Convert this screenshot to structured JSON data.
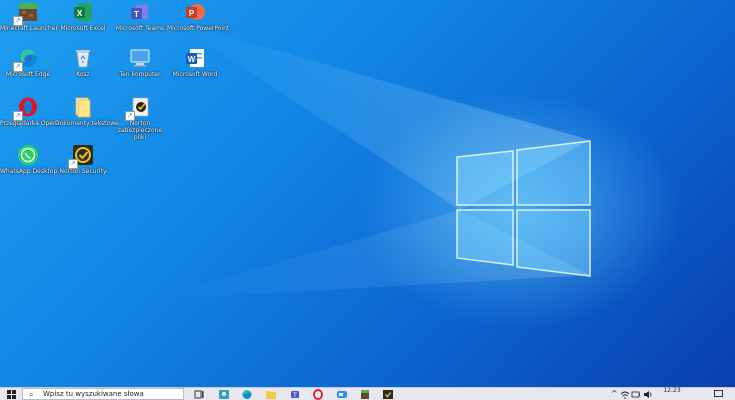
{
  "desktop": {
    "icons": [
      {
        "label": "Minecraft Launcher",
        "icon": "minecraft-icon"
      },
      {
        "label": "Microsoft Excel",
        "icon": "excel-icon"
      },
      {
        "label": "Microsoft Teams",
        "icon": "teams-icon"
      },
      {
        "label": "Microsoft PowerPoint",
        "icon": "powerpoint-icon"
      },
      {
        "label": "Microsoft Edge",
        "icon": "edge-icon"
      },
      {
        "label": "Kosz",
        "icon": "recycle-bin-icon"
      },
      {
        "label": "Ten komputer",
        "icon": "this-pc-icon"
      },
      {
        "label": "Microsoft Word",
        "icon": "word-icon"
      },
      {
        "label": "Przeglądarka Opera",
        "icon": "opera-icon"
      },
      {
        "label": "Dokumenty tekstowe",
        "icon": "folder-icon"
      },
      {
        "label": "Norton zabezpieczone pliki",
        "icon": "norton-files-icon"
      },
      {
        "label": "WhatsApp Desktop",
        "icon": "whatsapp-icon"
      },
      {
        "label": "Norton Security",
        "icon": "norton-icon"
      }
    ]
  },
  "taskbar": {
    "search_placeholder": "Wpisz tu wyszukiwane słowa",
    "clock_time": "12:23",
    "colors": {
      "background": "#e6e8ee",
      "accent": "#0078d7"
    }
  }
}
